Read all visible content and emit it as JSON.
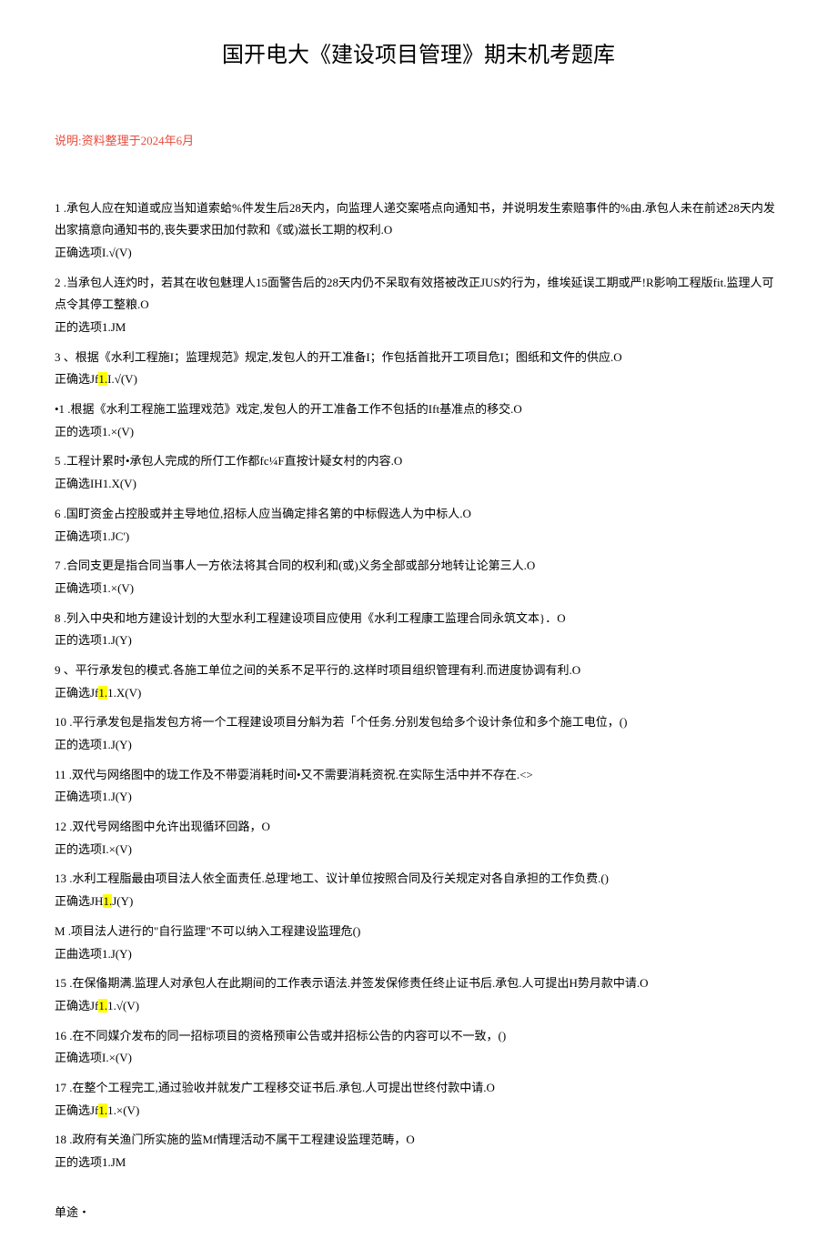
{
  "title": "国开电大《建设项目管理》期末机考题库",
  "note": "说明:资料整理于2024年6月",
  "questions": [
    {
      "num": "1",
      "text": ".承包人应在知道或应当知道索蛤%件发生后28天内，向监理人递交案嗒点向通知书，并说明发生索赔事件的%由.承包人未在前述28天内发出家搞意向通知书的,丧失要求田加付款和《或)滋长工期的权利.O",
      "answer": "正确选项I.√(V)"
    },
    {
      "num": "2",
      "text": ".当承包人连灼时，若其在收包魅理人15面警告后的28天内仍不呆取有效搭被改正JUS妁行为，维埃延误工期或严!R影响工程版fit.监理人可点令其停工整粮.O",
      "answer": "正的选项1.JM"
    },
    {
      "num": "3",
      "text": "、根据《水利工程施I；监理规范》规定,发包人的开工准备I；作包括首批开工项目危I；图纸和文仵的供应.O",
      "answer": "正确选Jf",
      "highlight": "1.",
      "answer_suffix": "I.√(V)"
    },
    {
      "num": "•1",
      "text": ".根据《水利工程施工监理戏范》戏定,发包人的开工准备工作不包括的Ift基准点的移交.O",
      "answer": "正的选项1.×(V)"
    },
    {
      "num": "5",
      "text": ".工程计累时•承包人完成的所仃工作都fc¼F直按计疑女村的内容.O",
      "answer": "正确选IH1.X(V)"
    },
    {
      "num": "6",
      "text": ".国盯资金占控股或并主导地位,招标人应当确定排名第的中标假选人为中标人.O",
      "answer": "正确选项1.JC')"
    },
    {
      "num": "7",
      "text": ".合同支更是指合同当事人一方依法将其合同的权利和(或)义务全部或部分地转让论第三人.O",
      "answer": "正确选项1.×(V)"
    },
    {
      "num": "8",
      "text": ".列入中央和地方建设计划的大型水利工程建设项目应使用《水利工程康工监理合同永筑文本}．O",
      "answer": "正的选项1.J(Y)"
    },
    {
      "num": "9",
      "text": "、平行承发包的模式.各施工单位之间的关系不足平行的.这样时项目组织管理有利.而进度协调有利.O",
      "answer": "正确选Jf",
      "highlight": "1.",
      "answer_suffix": "1.X(V)"
    },
    {
      "num": "10",
      "text": ".平行承发包是指发包方将一个工程建设项目分斛为若「个任务.分别发包给多个设计条位和多个施工电位，()",
      "answer": "正的选项1.J(Y)"
    },
    {
      "num": "11",
      "text": ".双代与网络图中的珑工作及不带耍消耗时间•又不需要消耗资祝.在实际生活中并不存在.<>",
      "answer": "正确选项1.J(Y)"
    },
    {
      "num": "12",
      "text": ".双代号网络图中允许出现循环回路，O",
      "answer": "正的选项I.×(V)"
    },
    {
      "num": "13",
      "text": ".水利工程脂最由项目法人依全面责任.总理'地工、议计单位按照合同及行关规定对各自承担的工作负费.()",
      "answer": "正确选JH",
      "highlight": "1.",
      "answer_suffix": "J(Y)"
    },
    {
      "num": "M",
      "text": ".项目法人进行的\"自行监理\"不可以纳入工程建设监理危()",
      "answer": "正曲选项1.J(Y)"
    },
    {
      "num": "15",
      "text": ".在保俻期满.监理人对承包人在此期间的工作表示语法.并签发保修责任终止证书后.承包.人可提出H势月款中请.O",
      "answer": "正确选Jf",
      "highlight": "1.",
      "answer_suffix": "1.√(V)"
    },
    {
      "num": "16",
      "text": ".在不同媒介发布的同一招标项目的资格预审公告或并招标公告的内容可以不一致，()",
      "answer": "正确选项I.×(V)"
    },
    {
      "num": "17",
      "text": ".在整个工程完工,通过验收并就发广工程移交证书后.承包.人可提出世终付款中请.O",
      "answer": "正确选Jf",
      "highlight": "1.",
      "answer_suffix": "1.×(V)"
    },
    {
      "num": "18",
      "text": ".政府有关渔门所实施的监Mf情理活动不属干工程建设监理范畴，O",
      "answer": "正的选项1.JM"
    }
  ],
  "section_label": "单途・"
}
